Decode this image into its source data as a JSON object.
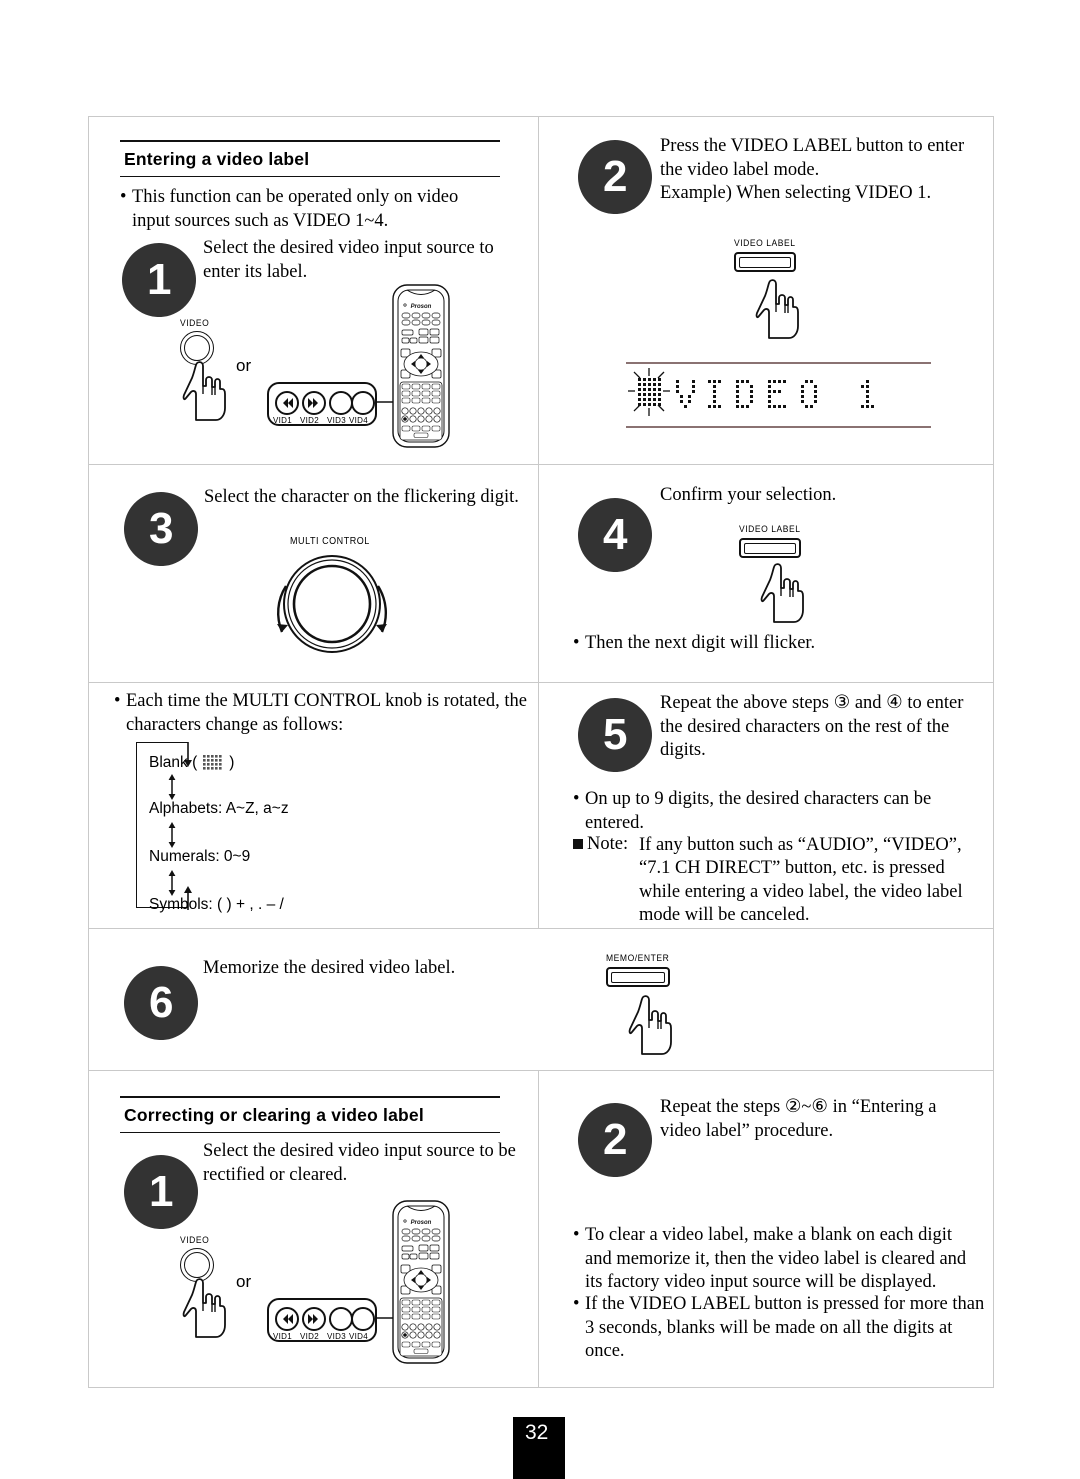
{
  "page": {
    "number": "32"
  },
  "sections": {
    "entering": {
      "heading": "Entering a video label",
      "intro_bullet": "This function can be operated only on video input sources such as VIDEO 1~4.",
      "steps": {
        "s1": {
          "num": "1",
          "text": "Select the desired video input source to enter its label."
        },
        "s2": {
          "num": "2",
          "text": "Press the VIDEO LABEL button to enter the video label mode.\nExample) When selecting VIDEO 1."
        },
        "s3": {
          "num": "3",
          "text": "Select the character on the flickering digit."
        },
        "s4": {
          "num": "4",
          "text": "Confirm your selection."
        },
        "s5": {
          "num": "5",
          "text": "Repeat the above steps ③ and ④ to enter the desired characters on the rest of the digits."
        },
        "s6": {
          "num": "6",
          "text": "Memorize the desired video label."
        }
      },
      "step4_note": "Then the next digit will flicker.",
      "step5_bullet": "On up to 9 digits, the desired characters can be entered.",
      "step5_note_label": "Note:",
      "step5_note": "If any button such as “AUDIO”, “VIDEO”, “7.1 CH DIRECT” button, etc. is pressed while entering a video label, the video label mode will be canceled.",
      "knob_bullet": "Each time the MULTI CONTROL knob is rotated, the characters change as follows:",
      "char_cycle": [
        {
          "label": "Blank (",
          "suffix": ")",
          "has_block": true
        },
        {
          "label": "Alphabets: A~Z, a~z",
          "suffix": "",
          "has_block": false
        },
        {
          "label": "Numerals: 0~9",
          "suffix": "",
          "has_block": false
        },
        {
          "label": "Symbols: ( ) + , .  –  /",
          "suffix": "",
          "has_block": false
        }
      ],
      "display": {
        "text": "VIDEO  1",
        "cursor": "flicker-block"
      }
    },
    "correcting": {
      "heading": "Correcting or clearing a video label",
      "steps": {
        "s1": {
          "num": "1",
          "text": "Select the desired video input source to be rectified or cleared."
        },
        "s2": {
          "num": "2",
          "text": "Repeat the steps ②~⑥ in “Entering a video label” procedure."
        }
      },
      "bullets": [
        "To clear a video label, make a blank on each digit and memorize it, then the video label is cleared and its factory video input source will be displayed.",
        "If the VIDEO LABEL button is pressed for more than 3 seconds, blanks will be made on all the digits at once."
      ]
    }
  },
  "hardware": {
    "video_knob_label": "VIDEO",
    "video_label_button": "VIDEO LABEL",
    "memo_enter_button": "MEMO/ENTER",
    "multi_control_label": "MULTI CONTROL",
    "or_text": "or",
    "remote_brand": "Proson",
    "vid_buttons": [
      "VID1",
      "VID2",
      "VID3",
      "VID4"
    ]
  },
  "colors": {
    "badge": "#333333",
    "rule": "#111111",
    "grid": "#c9c9c9",
    "display_rule": "#8a7272",
    "page_box": "#000000"
  }
}
